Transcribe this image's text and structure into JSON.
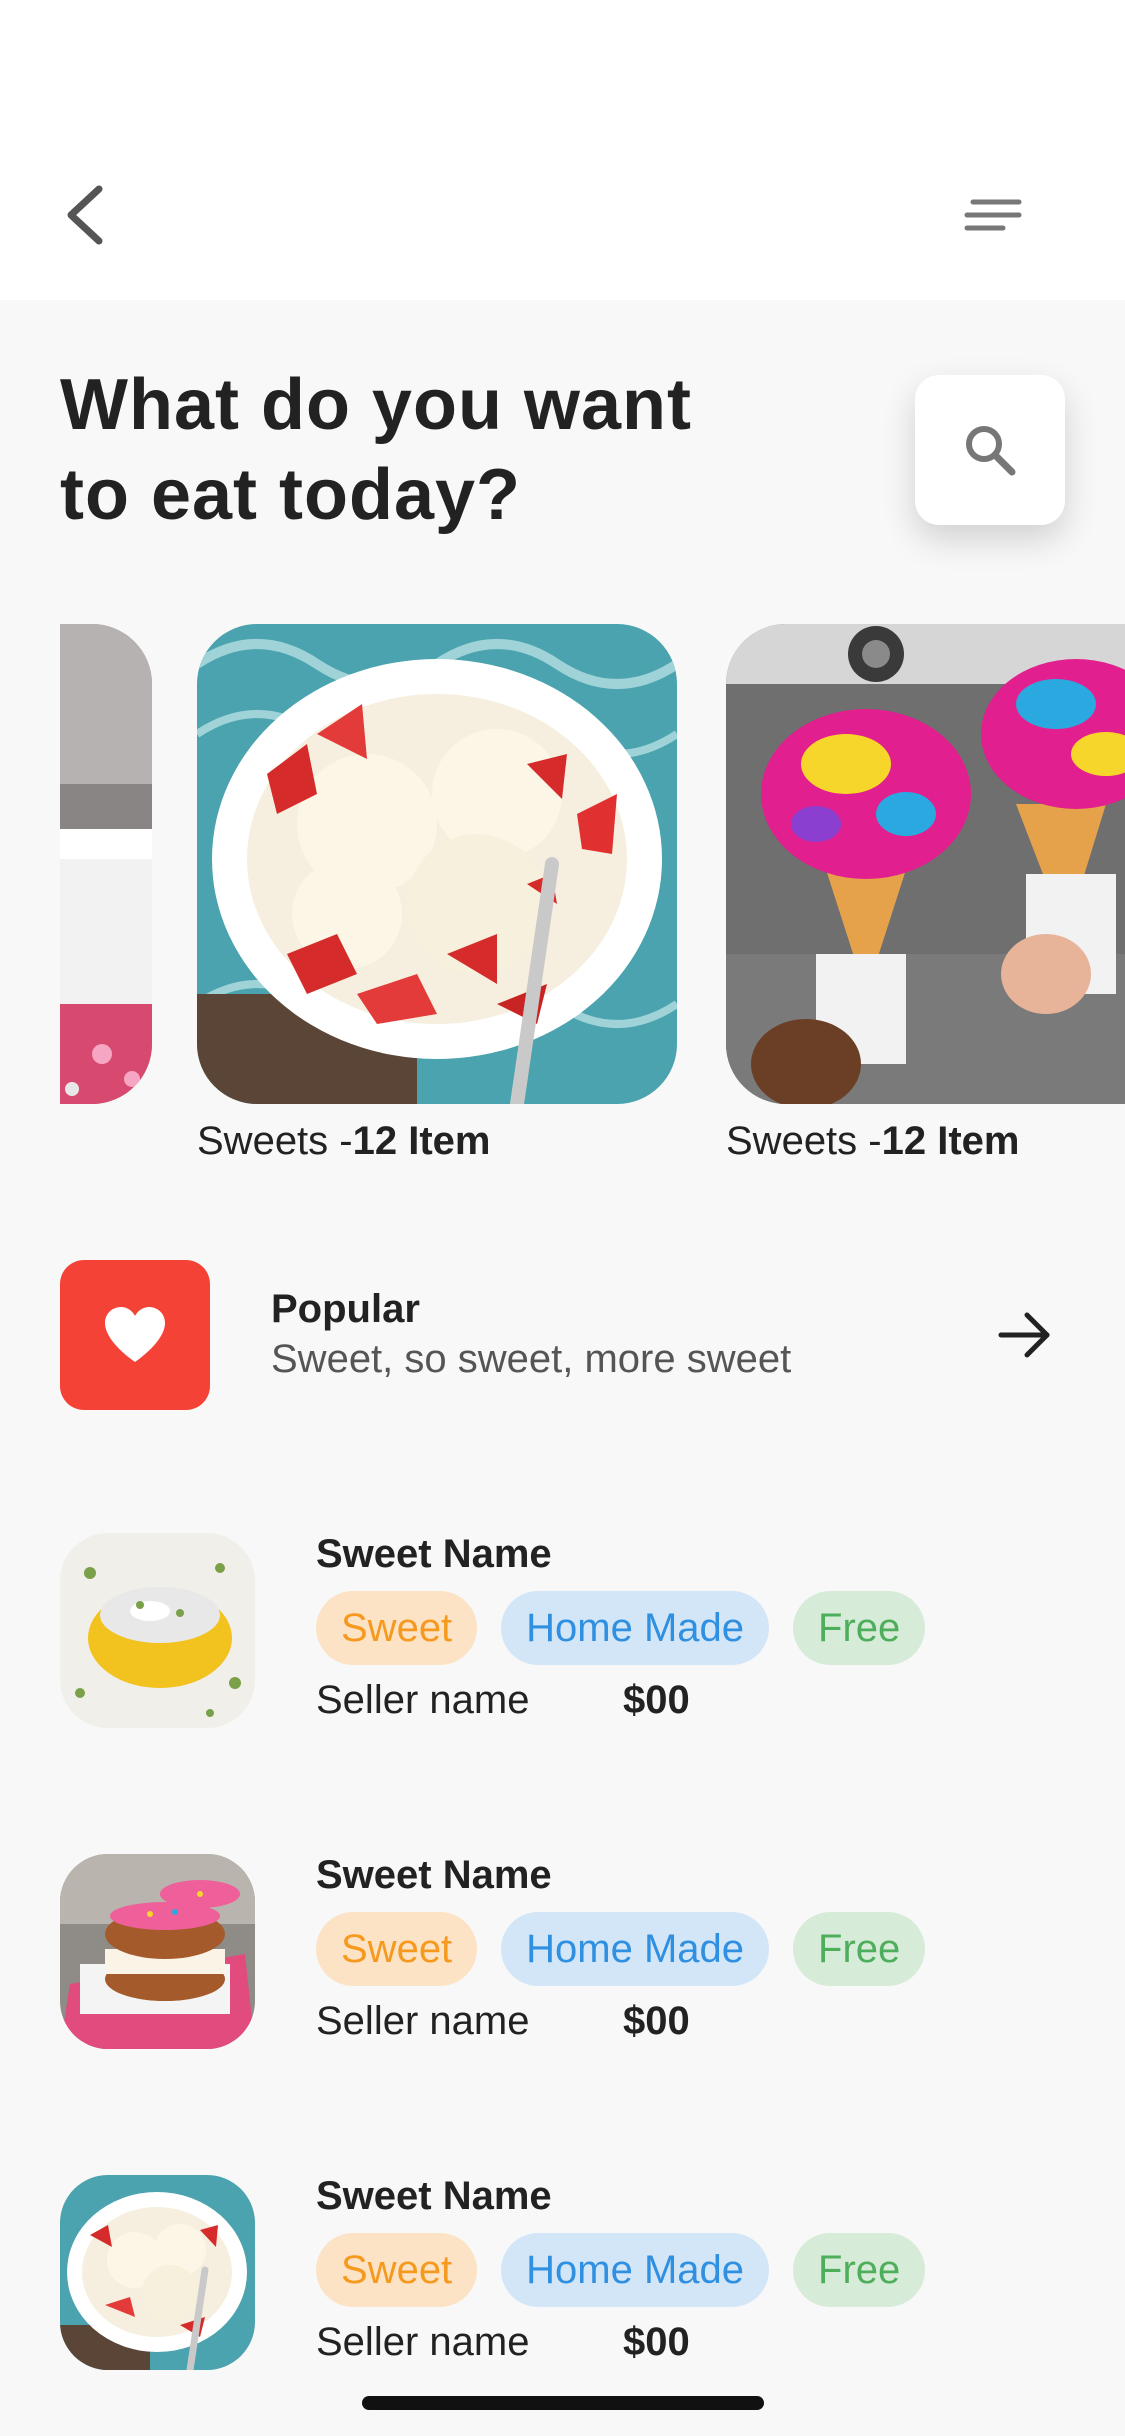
{
  "header": {
    "back_icon": "chevron-left-icon",
    "menu_icon": "menu-lines-icon"
  },
  "main": {
    "title_line1": "What do you want",
    "title_line2": "to eat today?",
    "search_icon": "search-icon"
  },
  "carousel": {
    "cards": [
      {
        "label_prefix": "",
        "label_count": "",
        "image": "cake-on-plate-photo"
      },
      {
        "label_prefix": "Sweets -",
        "label_count": "12 Item",
        "image": "ice-cream-bowl-strawberries-photo"
      },
      {
        "label_prefix": "Sweets -",
        "label_count": "12 Item",
        "image": "rainbow-ice-cream-cones-photo"
      }
    ]
  },
  "popular": {
    "icon": "heart-icon",
    "title": "Popular",
    "subtitle": "Sweet, so sweet, more sweet",
    "arrow_icon": "arrow-right-icon"
  },
  "items": [
    {
      "name": "Sweet Name",
      "tags": [
        "Sweet",
        "Home Made",
        "Free"
      ],
      "seller": "Seller name",
      "price": "$00",
      "image": "pistachio-sweet-photo"
    },
    {
      "name": "Sweet Name",
      "tags": [
        "Sweet",
        "Home Made",
        "Free"
      ],
      "seller": "Seller name",
      "price": "$00",
      "image": "donut-sandwich-photo"
    },
    {
      "name": "Sweet Name",
      "tags": [
        "Sweet",
        "Home Made",
        "Free"
      ],
      "seller": "Seller name",
      "price": "$00",
      "image": "ice-cream-bowl-photo"
    }
  ],
  "colors": {
    "background": "#f8f8f8",
    "header": "#ffffff",
    "accent_red": "#f44336",
    "tag_sweet_bg": "#fde3c6",
    "tag_sweet_text": "#f59a1f",
    "tag_home_bg": "#d3e6f7",
    "tag_home_text": "#2f8fe0",
    "tag_free_bg": "#d7ecd8",
    "tag_free_text": "#4fae5b"
  }
}
